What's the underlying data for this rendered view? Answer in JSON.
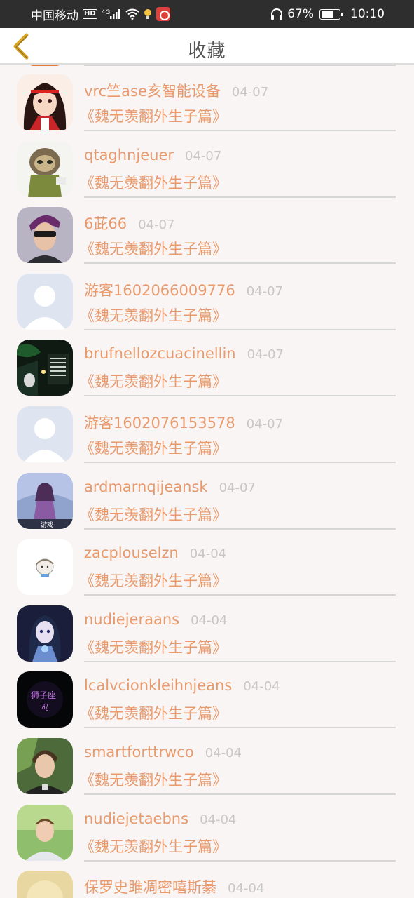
{
  "status_bar": {
    "carrier": "中国移动",
    "hd": "HD",
    "network": "4G",
    "battery_text": "67%",
    "battery_level": 0.67,
    "time": "10:10"
  },
  "header": {
    "title": "收藏",
    "back_icon": "chevron-left-icon"
  },
  "colors": {
    "accent": "#e99a6c",
    "date": "#c7c7c7",
    "status_bar": "#2e2e2e",
    "back_arrow": "#d9a520"
  },
  "favorites": [
    {
      "name": "vrc竺ase亥智能设备",
      "date": "04-07",
      "book": "《魏无羡翻外生子篇》",
      "avatar": "anime-girl-avatar"
    },
    {
      "name": "qtaghnjeuer",
      "date": "04-07",
      "book": "《魏无羡翻外生子篇》",
      "avatar": "sloth-avatar"
    },
    {
      "name": "6茈66",
      "date": "04-07",
      "book": "《魏无羡翻外生子篇》",
      "avatar": "sunglasses-man-avatar"
    },
    {
      "name": "游客1602066009776",
      "date": "04-07",
      "book": "《魏无羡翻外生子篇》",
      "avatar": "default-user-avatar"
    },
    {
      "name": "brufnellozcuacinellin",
      "date": "04-07",
      "book": "《魏无羡翻外生子篇》",
      "avatar": "night-girl-avatar"
    },
    {
      "name": "游客1602076153578",
      "date": "04-07",
      "book": "《魏无羡翻外生子篇》",
      "avatar": "default-user-avatar"
    },
    {
      "name": "ardmarnqijeansk",
      "date": "04-07",
      "book": "《魏无羡翻外生子篇》",
      "avatar": "fantasy-game-avatar"
    },
    {
      "name": "zacplouselzn",
      "date": "04-04",
      "book": "《魏无羡翻外生子篇》",
      "avatar": "cartoon-face-avatar"
    },
    {
      "name": "nudiejeraans",
      "date": "04-04",
      "book": "《魏无羡翻外生子篇》",
      "avatar": "anime-blue-girl-avatar"
    },
    {
      "name": "lcalvcionkleihnjeans",
      "date": "04-04",
      "book": "《魏无羡翻外生子篇》",
      "avatar": "leo-zodiac-avatar"
    },
    {
      "name": "smartforttrwco",
      "date": "04-04",
      "book": "《魏无羡翻外生子篇》",
      "avatar": "young-man-avatar"
    },
    {
      "name": "nudiejetaebns",
      "date": "04-04",
      "book": "《魏无羡翻外生子篇》",
      "avatar": "outdoor-man-avatar"
    },
    {
      "name": "保罗史雎凋密嘻斯綦",
      "date": "04-04",
      "book": "",
      "avatar": "blurred-portrait-avatar"
    }
  ]
}
